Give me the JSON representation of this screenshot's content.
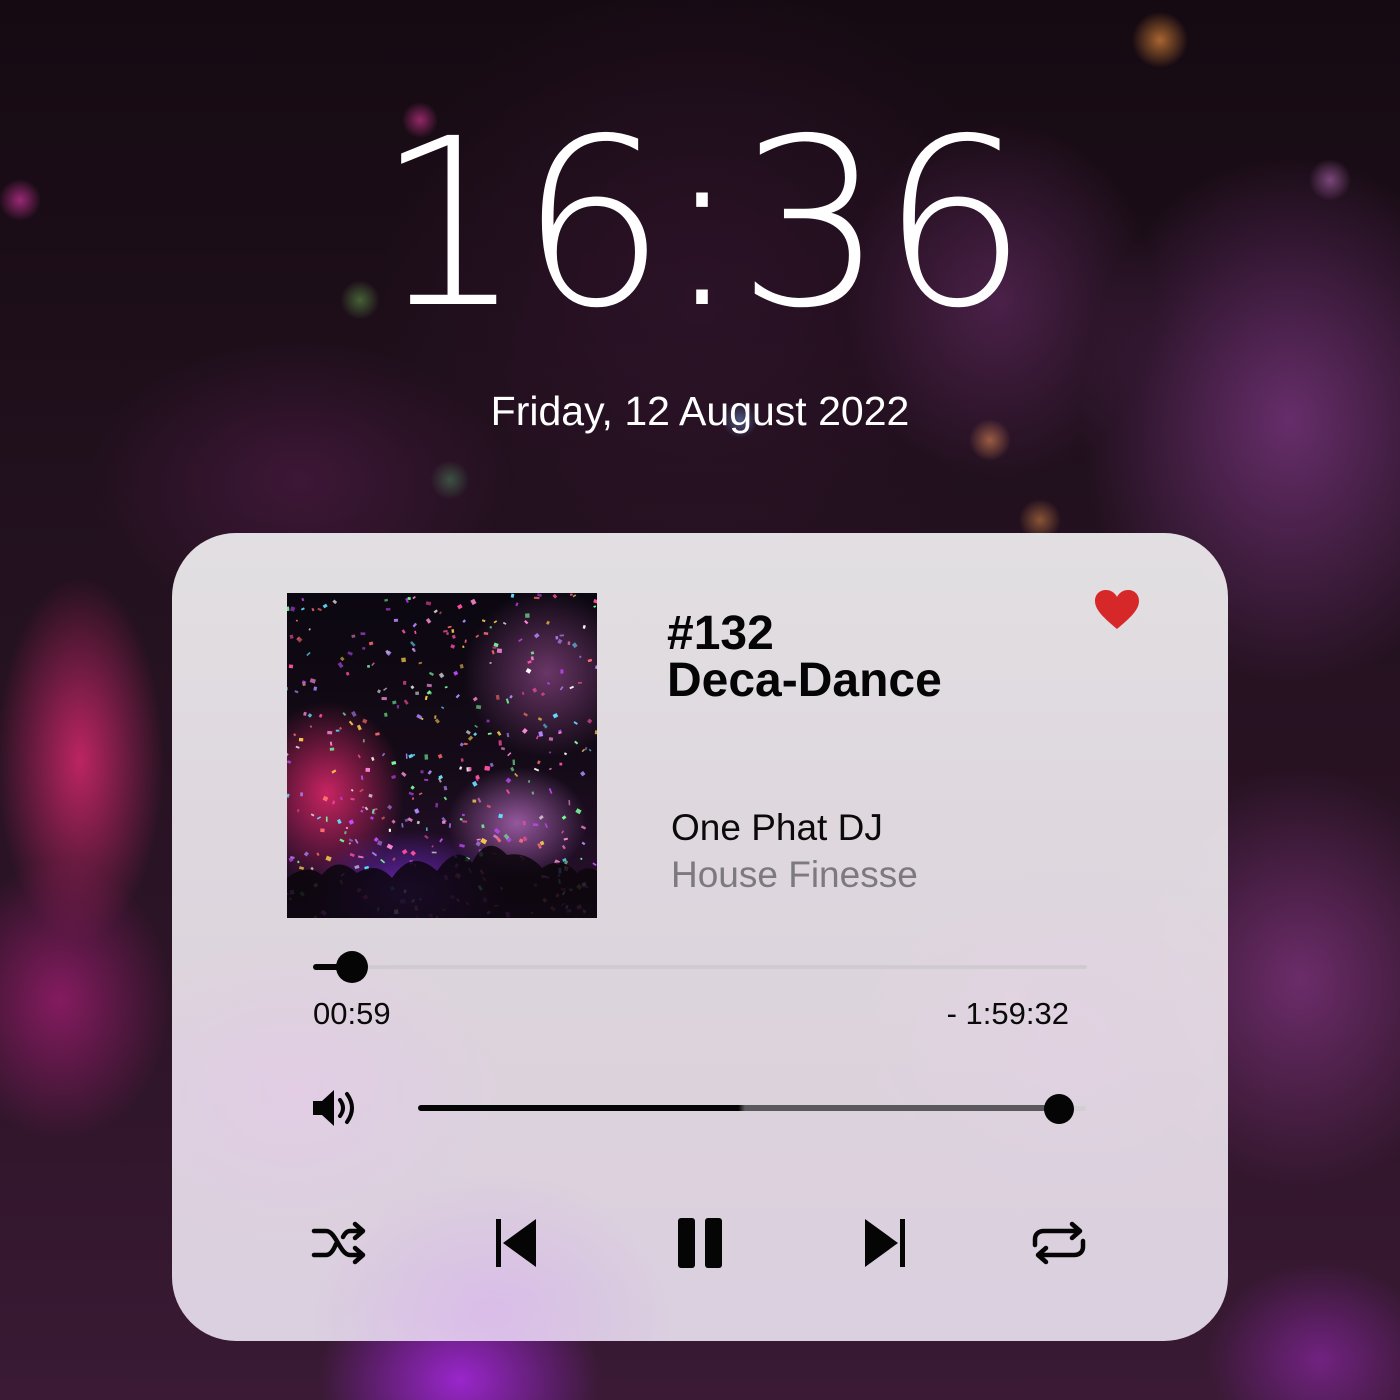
{
  "lockscreen": {
    "time": "16:36",
    "date": "Friday, 12 August 2022"
  },
  "player": {
    "track_number": "#132",
    "title": "Deca-Dance",
    "artist": "One Phat DJ",
    "album": "House Finesse",
    "favorited": true,
    "progress": {
      "elapsed": "00:59",
      "remaining": "- 1:59:32",
      "fraction": 0.05
    },
    "volume": {
      "fraction": 0.96
    },
    "controls": {
      "shuffle": "shuffle-icon",
      "previous": "skip-previous-icon",
      "play_pause": "pause-icon",
      "next": "skip-next-icon",
      "repeat": "repeat-icon"
    },
    "colors": {
      "heart": "#d62828",
      "text": "#050505",
      "album_text": "#7c7a7e"
    }
  }
}
